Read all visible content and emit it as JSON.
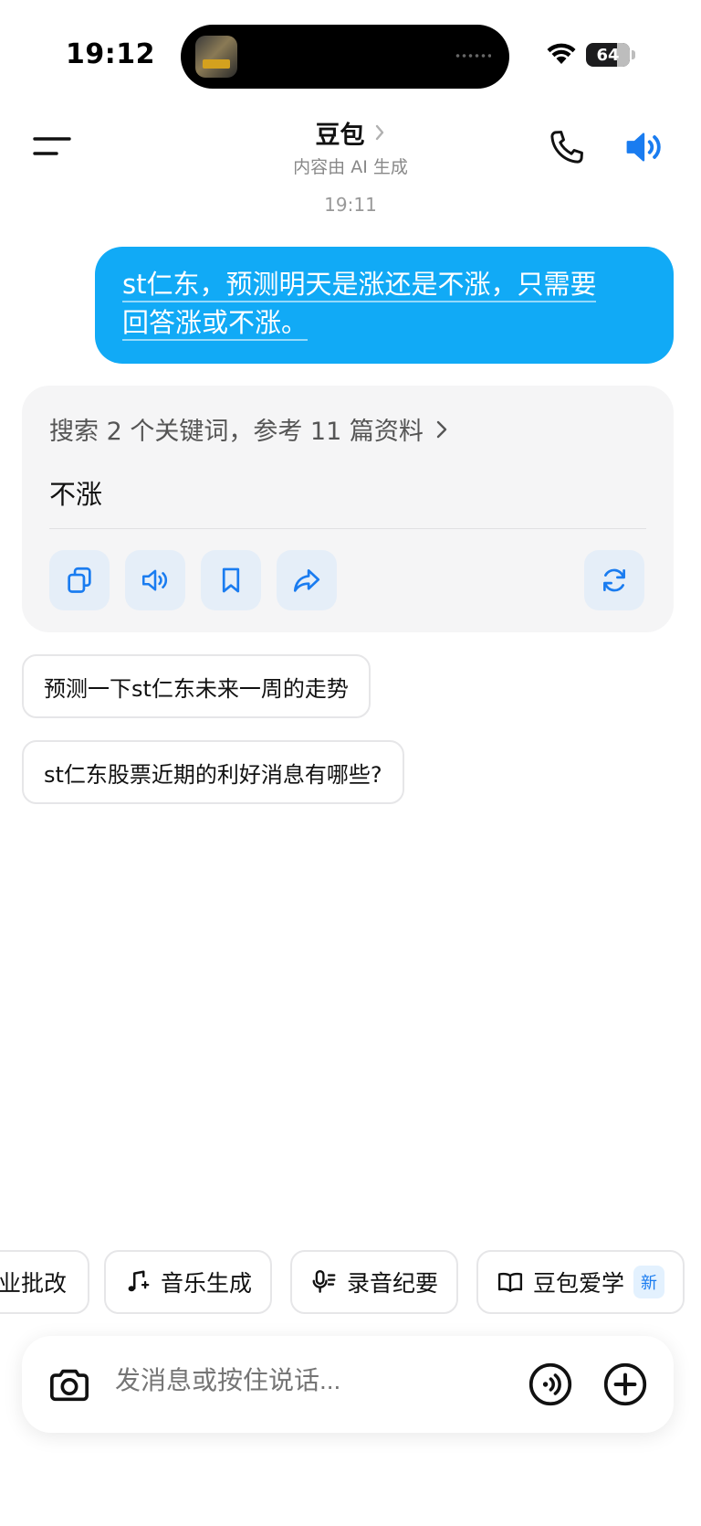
{
  "status_bar": {
    "time": "19:12",
    "battery": "64"
  },
  "header": {
    "title": "豆包",
    "subtitle": "内容由 AI 生成"
  },
  "chat": {
    "timestamp": "19:11",
    "user_message": {
      "line1": "st仁东，预测明天是涨还是不涨，只需要",
      "line2": "回答涨或不涨。"
    },
    "answer": {
      "search_summary": "搜索 2 个关键词，参考 11 篇资料",
      "text": "不涨",
      "actions": [
        "copy-icon",
        "read-aloud-icon",
        "bookmark-icon",
        "share-icon",
        "regenerate-icon"
      ]
    },
    "suggestions": [
      "预测一下st仁东未来一周的走势",
      "st仁东股票近期的利好消息有哪些?"
    ]
  },
  "tools": {
    "items": [
      {
        "label": "业批改",
        "icon": ""
      },
      {
        "label": "音乐生成",
        "icon": "music-note-icon"
      },
      {
        "label": "录音纪要",
        "icon": "microphone-icon"
      },
      {
        "label": "豆包爱学",
        "icon": "book-icon",
        "badge": "新"
      }
    ]
  },
  "input": {
    "placeholder": "发消息或按住说话..."
  },
  "colors": {
    "accent": "#11aaf6",
    "icon_blue": "#1a7cf0",
    "card_bg": "#f5f5f6",
    "action_bg": "#e5eef8"
  }
}
